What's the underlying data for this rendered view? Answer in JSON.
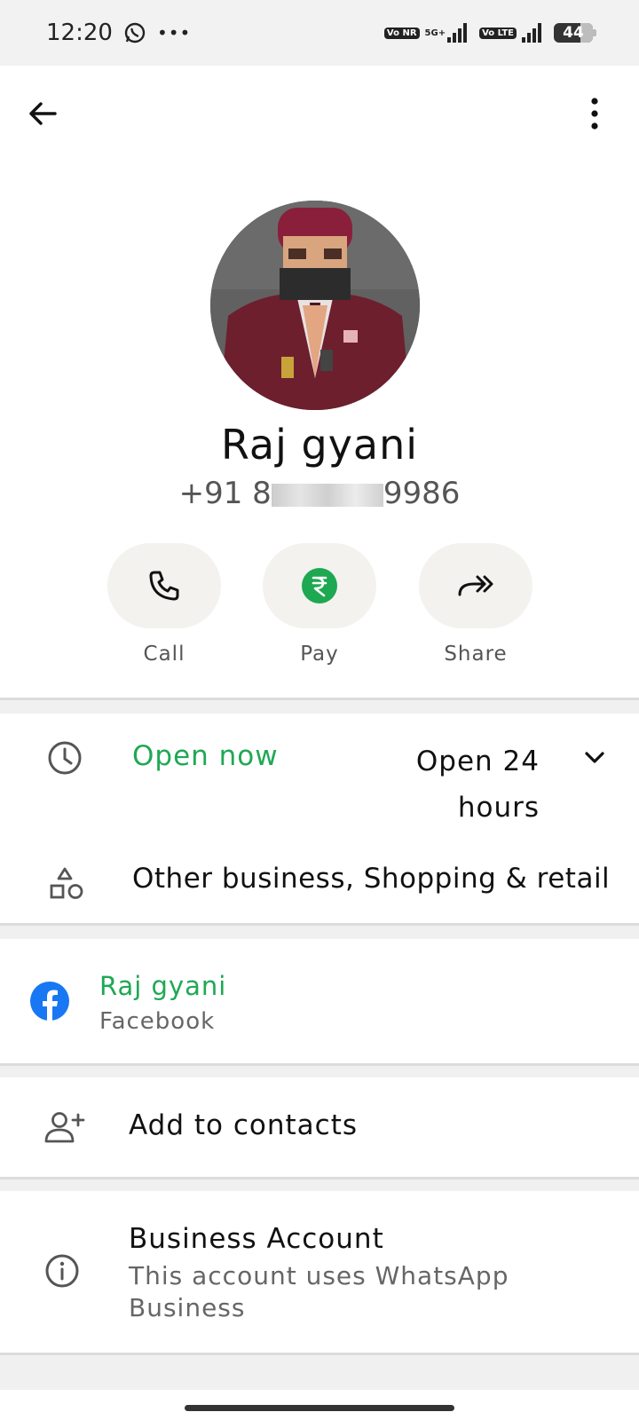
{
  "status_bar": {
    "time": "12:20",
    "network_label": "5G+",
    "sim1_badge": "Vo NR",
    "sim2_badge": "Vo LTE",
    "battery": "44"
  },
  "profile": {
    "name": "Raj gyani",
    "phone_prefix": "+91 8",
    "phone_suffix": "9986"
  },
  "actions": [
    {
      "label": "Call"
    },
    {
      "label": "Pay"
    },
    {
      "label": "Share"
    }
  ],
  "business": {
    "status": "Open now",
    "status_color": "#1fa855",
    "hours_line1": "Open 24",
    "hours_line2": "hours",
    "category": "Other business, Shopping & retail"
  },
  "facebook": {
    "name": "Raj gyani",
    "source": "Facebook",
    "brand_color": "#1877f2"
  },
  "add_contacts": {
    "label": "Add to contacts"
  },
  "business_account": {
    "title": "Business Account",
    "description": "This account uses WhatsApp Business"
  },
  "colors": {
    "accent_green": "#1fa855",
    "pay_green": "#1da851"
  }
}
